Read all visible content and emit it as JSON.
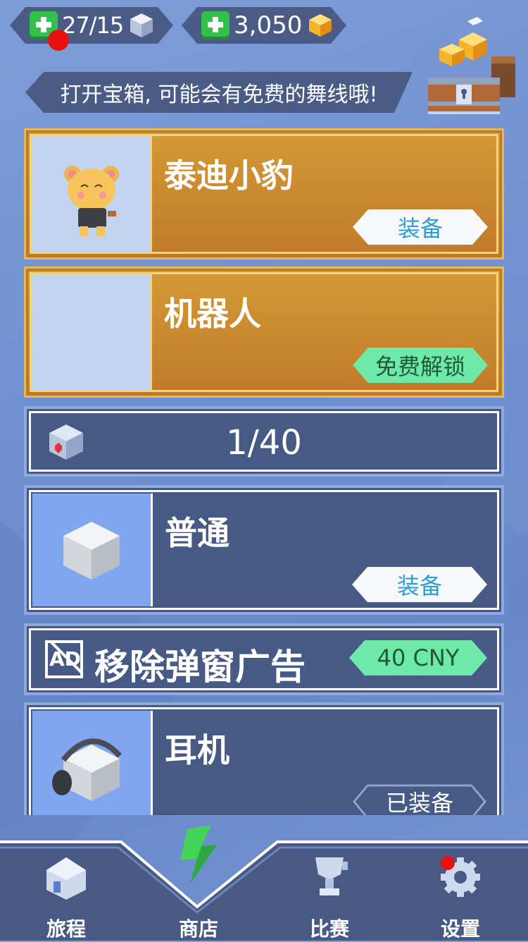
{
  "currencies": {
    "energy_value": "27/15",
    "coins_value": "3,050"
  },
  "hint": {
    "text": "打开宝箱, 可能会有免费的舞线哦!"
  },
  "items": [
    {
      "title": "泰迪小豹",
      "action": "装备",
      "style": "gold",
      "tag_style": "white"
    },
    {
      "title": "机器人",
      "action": "免费解锁",
      "style": "gold",
      "tag_style": "green"
    }
  ],
  "collection": {
    "progress": "1/40"
  },
  "items2": [
    {
      "title": "普通",
      "action": "装备"
    }
  ],
  "remove_ads": {
    "label": "移除弹窗广告",
    "price": "40 CNY",
    "icon_text": "AD"
  },
  "items3": [
    {
      "title": "耳机",
      "action": "已装备"
    }
  ],
  "nav": {
    "journey": "旅程",
    "shop": "商店",
    "match": "比赛",
    "settings": "设置"
  },
  "colors": {
    "accent_green": "#31c04a",
    "gold_card": "#c8862d",
    "blue_card": "#475a85",
    "tag_blue_text": "#2e9fd6"
  }
}
